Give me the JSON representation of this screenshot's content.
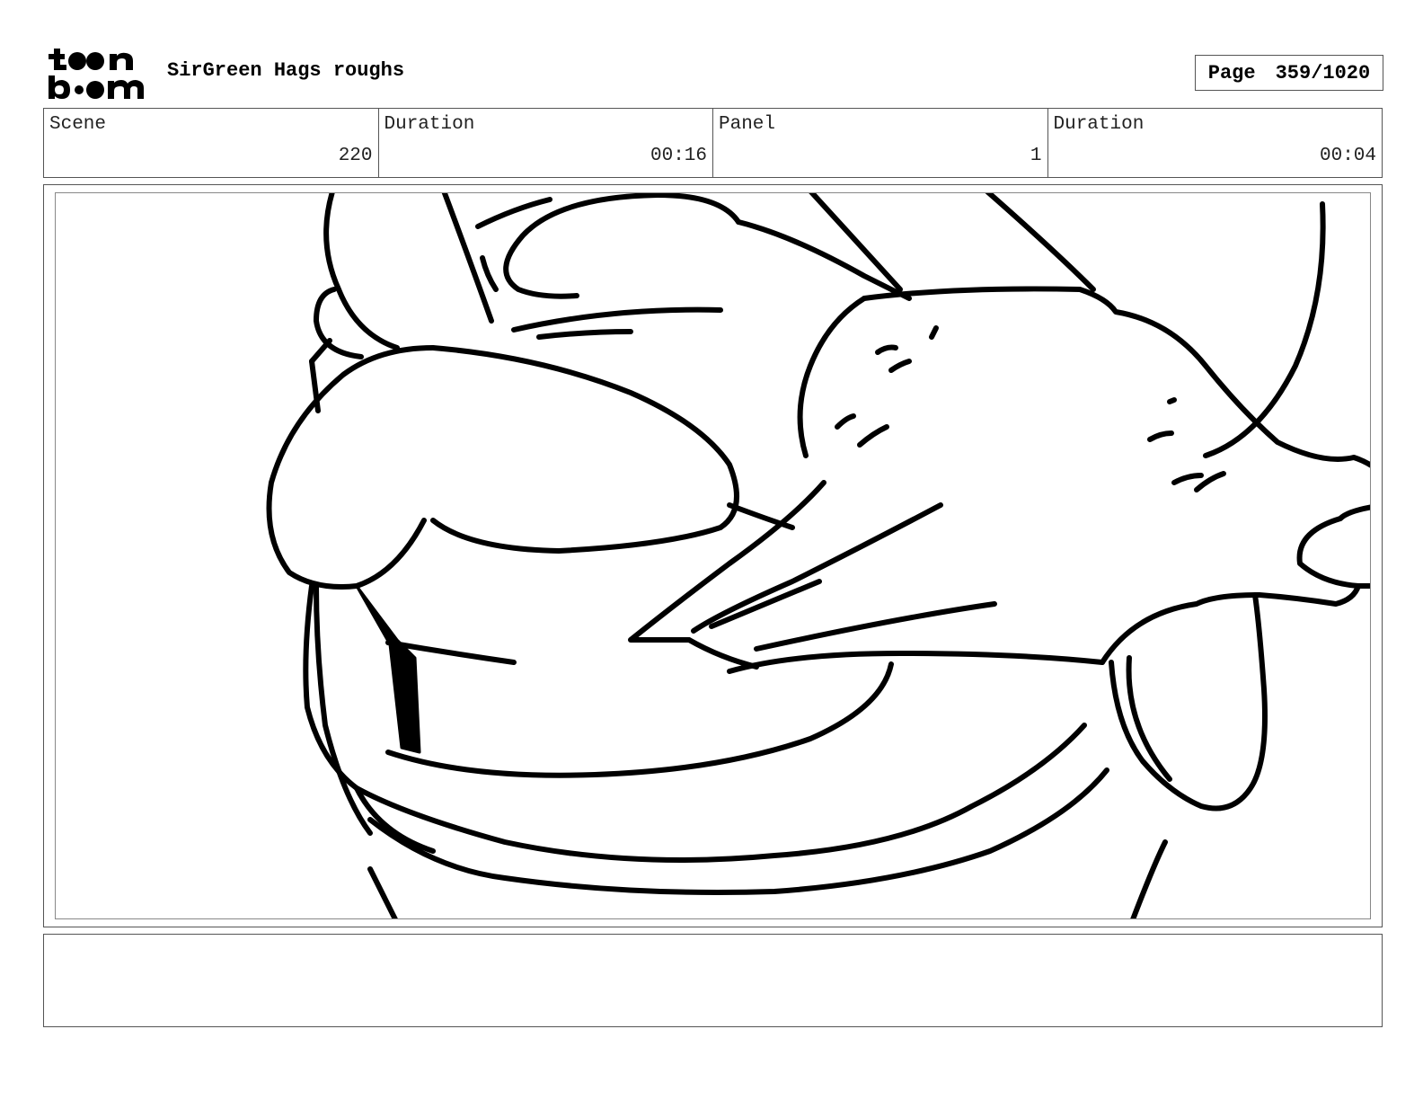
{
  "header": {
    "logo_text": "toon boom",
    "title": "SirGreen Hags roughs",
    "page_label": "Page",
    "page_value": "359/1020"
  },
  "info": {
    "scene_label": "Scene",
    "scene_value": "220",
    "duration1_label": "Duration",
    "duration1_value": "00:16",
    "panel_label": "Panel",
    "panel_value": "1",
    "duration2_label": "Duration",
    "duration2_value": "00:04"
  },
  "notes": {
    "text": ""
  }
}
